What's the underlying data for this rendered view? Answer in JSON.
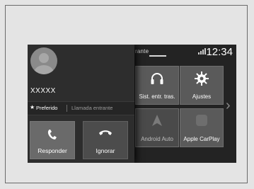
{
  "status": {
    "ticker_text": "rante",
    "clock": "12:34"
  },
  "call": {
    "caller_name": "XXXXX",
    "favorite_label": "Preferido",
    "incoming_label": "Llamada entrante",
    "answer_label": "Responder",
    "ignore_label": "Ignorar"
  },
  "tiles": [
    {
      "label": "Sist. entr. tras.",
      "icon": "headphones-icon"
    },
    {
      "label": "Ajustes",
      "icon": "gear-icon"
    },
    {
      "label": "Android Auto",
      "icon": "android-auto-icon"
    },
    {
      "label": "Apple CarPlay",
      "icon": "carplay-icon"
    }
  ],
  "colors": {
    "screen_bg": "#232323",
    "tile_bg": "#5a5a5a",
    "accept_btn": "#6a6a6a",
    "reject_btn": "#4c4c4c"
  }
}
